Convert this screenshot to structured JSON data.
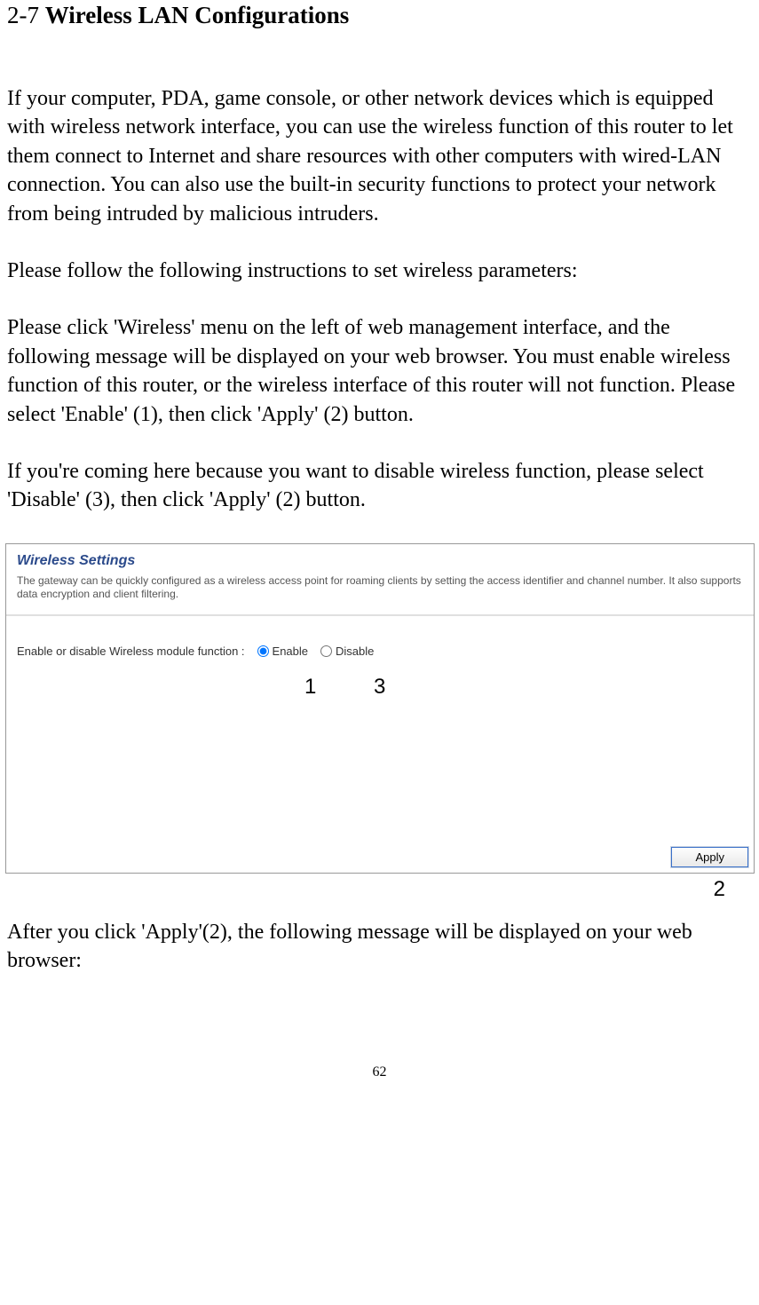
{
  "heading": {
    "number": "2-7",
    "title": "Wireless LAN Configurations"
  },
  "paragraphs": {
    "p1": "If your computer, PDA, game console, or other network devices which is equipped with wireless network interface, you can use the wireless function of this router to let them connect to Internet and share resources with other computers with wired-LAN connection. You can also use the built-in security functions to protect your network from being intruded by malicious intruders.",
    "p2": "Please follow the following instructions to set wireless parameters:",
    "p3": "Please click 'Wireless' menu on the left of web management interface, and the following message will be displayed on your web browser. You must enable wireless function of this router, or the wireless interface of this router will not function. Please select 'Enable' (1), then click 'Apply' (2) button.",
    "p4": "If you're coming here because you want to disable wireless function, please select 'Disable' (3), then click 'Apply' (2) button.",
    "p5": "After you click 'Apply'(2), the following message will be displayed on your web browser:"
  },
  "panel": {
    "title": "Wireless Settings",
    "description": "The gateway can be quickly configured as a wireless access point for roaming clients by setting the access identifier and channel number. It also supports data encryption and client filtering.",
    "radioLabel": "Enable or disable Wireless module function :",
    "optionEnable": "Enable",
    "optionDisable": "Disable",
    "applyLabel": "Apply"
  },
  "annotations": {
    "a1": "1",
    "a2": "2",
    "a3": "3"
  },
  "pageNumber": "62"
}
